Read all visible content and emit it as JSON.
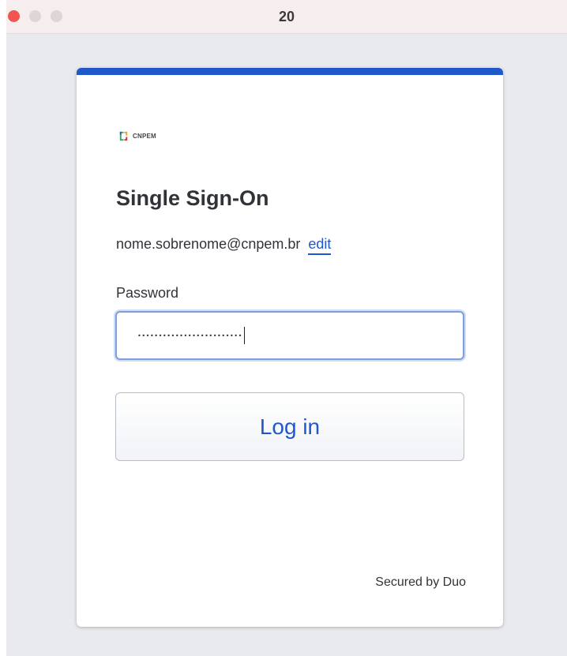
{
  "window": {
    "title": "20"
  },
  "logo": {
    "text": "CNPEM",
    "icon": "cnpem-logo-icon"
  },
  "login": {
    "heading": "Single Sign-On",
    "email": "nome.sobrenome@cnpem.br",
    "edit_label": "edit",
    "password_label": "Password",
    "password_value": "•••••••••••••••••••••••••",
    "login_button": "Log in"
  },
  "footer": {
    "secured_text": "Secured by Duo"
  },
  "colors": {
    "accent": "#1f58c9",
    "close_button": "#f0554f"
  }
}
